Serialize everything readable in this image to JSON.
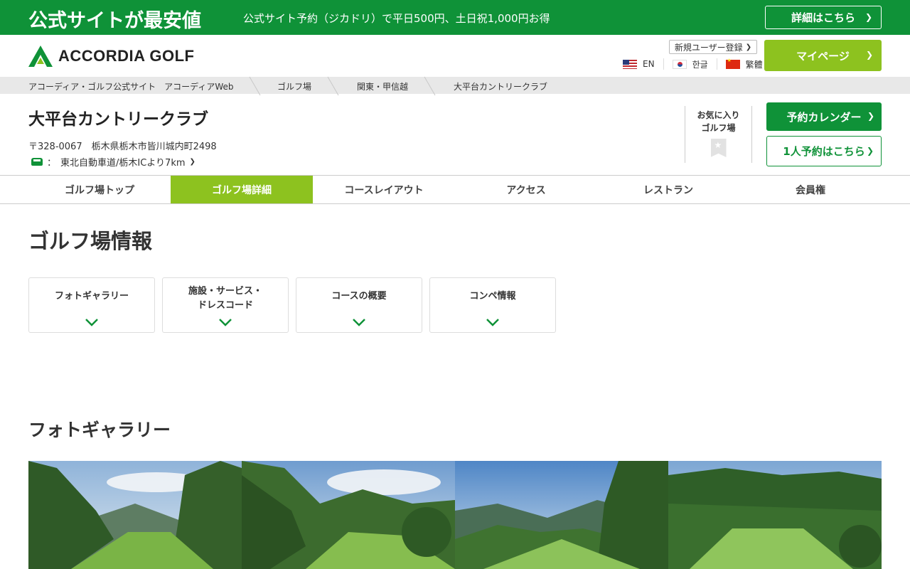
{
  "banner": {
    "title": "公式サイトが最安値",
    "subtitle": "公式サイト予約（ジカドリ）で平日500円、土日祝1,000円お得",
    "button": "詳細はこちら"
  },
  "header": {
    "logo_text": "ACCORDIA GOLF",
    "new_user": "新規ユーザー登録",
    "mypage": "マイページ",
    "languages": [
      {
        "label": "EN",
        "flag": "us-flag-icon"
      },
      {
        "label": "한글",
        "flag": "kr-flag-icon"
      },
      {
        "label": "繁體",
        "flag": "cn-flag-icon"
      }
    ]
  },
  "breadcrumb": [
    "アコーディア・ゴルフ公式サイト　アコーディアWeb",
    "ゴルフ場",
    "関東・甲信越",
    "大平台カントリークラブ"
  ],
  "course": {
    "name": "大平台カントリークラブ",
    "address": "〒328-0067　栃木県栃木市皆川城内町2498",
    "access_prefix": "：",
    "access": "東北自動車道/栃木ICより7km",
    "favorite_line1": "お気に入り",
    "favorite_line2": "ゴルフ場",
    "calendar_button": "予約カレンダー",
    "solo_button": "1人予約はこちら"
  },
  "tabs": [
    {
      "label": "ゴルフ場トップ",
      "active": false
    },
    {
      "label": "ゴルフ場詳細",
      "active": true
    },
    {
      "label": "コースレイアウト",
      "active": false
    },
    {
      "label": "アクセス",
      "active": false
    },
    {
      "label": "レストラン",
      "active": false
    },
    {
      "label": "会員権",
      "active": false
    }
  ],
  "section": {
    "title": "ゴルフ場情報",
    "cards": [
      {
        "line1": "フォトギャラリー",
        "line2": ""
      },
      {
        "line1": "施設・サービス・",
        "line2": "ドレスコード"
      },
      {
        "line1": "コースの概要",
        "line2": ""
      },
      {
        "line1": "コンペ情報",
        "line2": ""
      }
    ]
  },
  "gallery": {
    "title": "フォトギャラリー"
  },
  "colors": {
    "green": "#0f9238",
    "lime": "#8dc21f",
    "breadcrumb_bg": "#e8e8e8"
  }
}
